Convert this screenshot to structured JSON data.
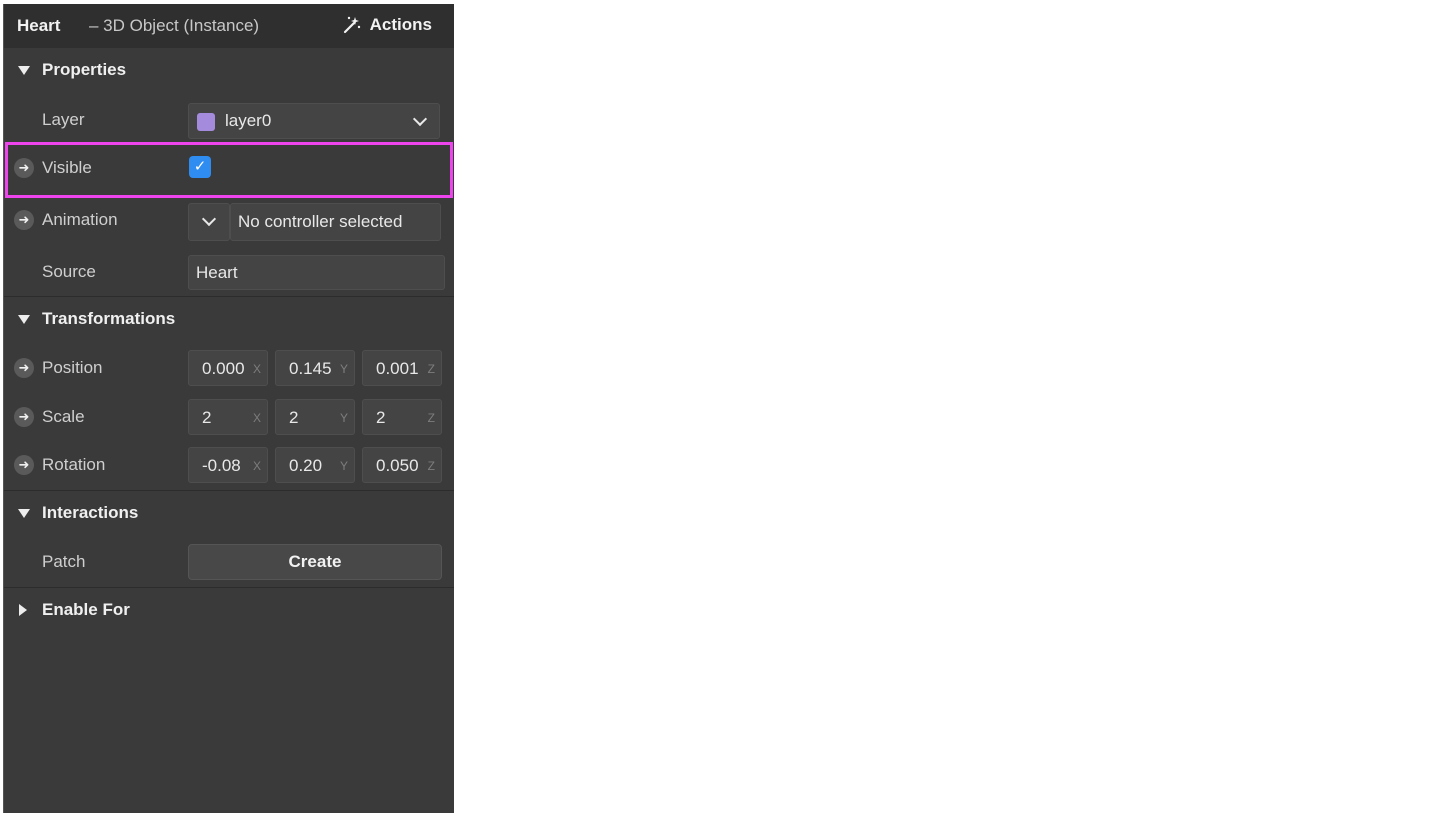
{
  "header": {
    "title": "Heart",
    "subtitle": "– 3D Object (Instance)",
    "actions_label": "Actions",
    "actions_icon": "magic-wand-icon"
  },
  "sections": {
    "properties": {
      "label": "Properties",
      "expanded": true
    },
    "transformations": {
      "label": "Transformations",
      "expanded": true
    },
    "interactions": {
      "label": "Interactions",
      "expanded": true
    },
    "enable_for": {
      "label": "Enable For",
      "expanded": false
    }
  },
  "properties": {
    "layer": {
      "label": "Layer",
      "value": "layer0",
      "swatch_color": "#a58bdc"
    },
    "visible": {
      "label": "Visible",
      "checked": true,
      "check_glyph": "✓"
    },
    "animation": {
      "label": "Animation",
      "value": "No controller selected"
    },
    "source": {
      "label": "Source",
      "value": "Heart"
    }
  },
  "transformations": {
    "position": {
      "label": "Position",
      "x": "0.000",
      "y": "0.145",
      "z": "0.001"
    },
    "scale": {
      "label": "Scale",
      "x": "2",
      "y": "2",
      "z": "2"
    },
    "rotation": {
      "label": "Rotation",
      "x": "-0.08",
      "y": "0.20",
      "z": "0.050"
    }
  },
  "axes": {
    "x": "X",
    "y": "Y",
    "z": "Z"
  },
  "interactions": {
    "patch": {
      "label": "Patch",
      "button": "Create"
    }
  },
  "arrow_glyph": "➜",
  "colors": {
    "panel_bg": "#3a3a3a",
    "checkbox_accent": "#2f8cf0",
    "highlight": "#ee44ee"
  }
}
